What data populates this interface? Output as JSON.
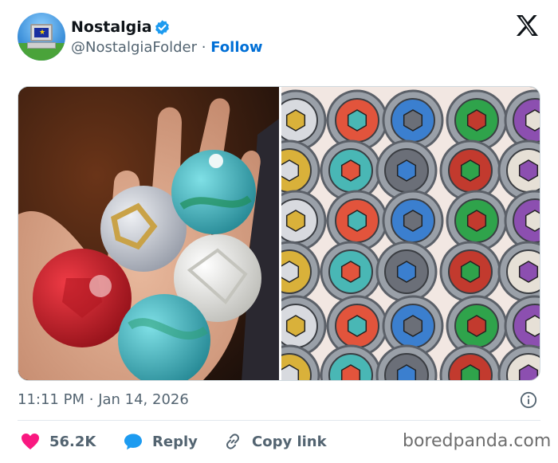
{
  "author": {
    "name": "Nostalgia",
    "handle": "@NostalgiaFolder",
    "separator": "·",
    "follow_label": "Follow",
    "verified": true,
    "avatar_icon": "retro-computer-icon"
  },
  "platform_icon": "x-logo-icon",
  "media": {
    "left": {
      "description_icon": "bakugan-balls-photo",
      "balls": [
        {
          "color": "#c61d2a"
        },
        {
          "color": "#c9cdd6"
        },
        {
          "color": "#2aa6b5"
        },
        {
          "color": "#ececea"
        },
        {
          "color": "#2c9aa8"
        }
      ]
    },
    "right": {
      "description_icon": "beyblades-collection-photo"
    }
  },
  "post": {
    "time": "11:11 PM",
    "separator": "·",
    "date": "Jan 14, 2026"
  },
  "actions": {
    "like_count": "56.2K",
    "reply_label": "Reply",
    "copy_label": "Copy link"
  },
  "colors": {
    "like": "#f91880",
    "reply": "#1d9bf0",
    "link": "#006fd6",
    "muted": "#536471"
  },
  "watermark": "boredpanda.com"
}
